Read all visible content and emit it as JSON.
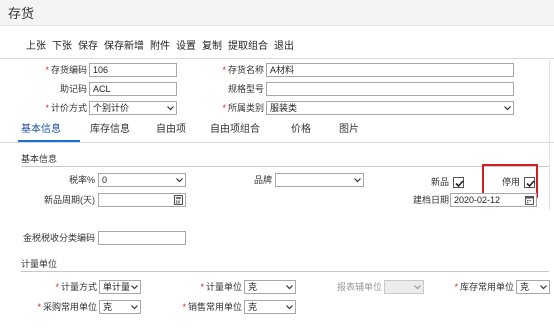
{
  "window": {
    "title": "存货"
  },
  "toolbar": {
    "items": [
      "上张",
      "下张",
      "保存",
      "保存新增",
      "附件",
      "设置",
      "复制",
      "提取组合",
      "退出"
    ]
  },
  "header_form": {
    "code_label": "存货编码",
    "code_value": "106",
    "name_label": "存货名称",
    "name_value": "A材料",
    "mnemonic_label": "助记码",
    "mnemonic_value": "ACL",
    "spec_label": "规格型号",
    "spec_value": "",
    "pricing_label": "计价方式",
    "pricing_value": "个别计价",
    "category_label": "所属类别",
    "category_value": "服装类"
  },
  "tabs": [
    "基本信息",
    "库存信息",
    "自由项",
    "自由项组合",
    "价格",
    "图片"
  ],
  "basic_section": {
    "title": "基本信息",
    "tax_label": "税率%",
    "tax_value": "0",
    "brand_label": "品牌",
    "brand_value": "",
    "new_label": "新品",
    "new_checked": true,
    "disable_label": "停用",
    "disable_checked": true,
    "new_period_label": "新品周期(天)",
    "new_period_value": "",
    "created_label": "建档日期",
    "created_value": "2020-02-12",
    "tax_class_label": "金税税收分类编码",
    "tax_class_value": ""
  },
  "unit_section": {
    "title": "计量单位",
    "method_label": "计量方式",
    "method_value": "单计量",
    "unit_label": "计量单位",
    "unit_value": "克",
    "report_unit_label": "报表辅单位",
    "report_unit_value": "",
    "stock_unit_label": "库存常用单位",
    "stock_unit_value": "克",
    "purchase_unit_label": "采购常用单位",
    "purchase_unit_value": "克",
    "sales_unit_label": "销售常用单位",
    "sales_unit_value": "克"
  },
  "colors": {
    "required": "#d22222",
    "highlight": "#d01f1f",
    "active_tab": "#1a6fd0"
  }
}
